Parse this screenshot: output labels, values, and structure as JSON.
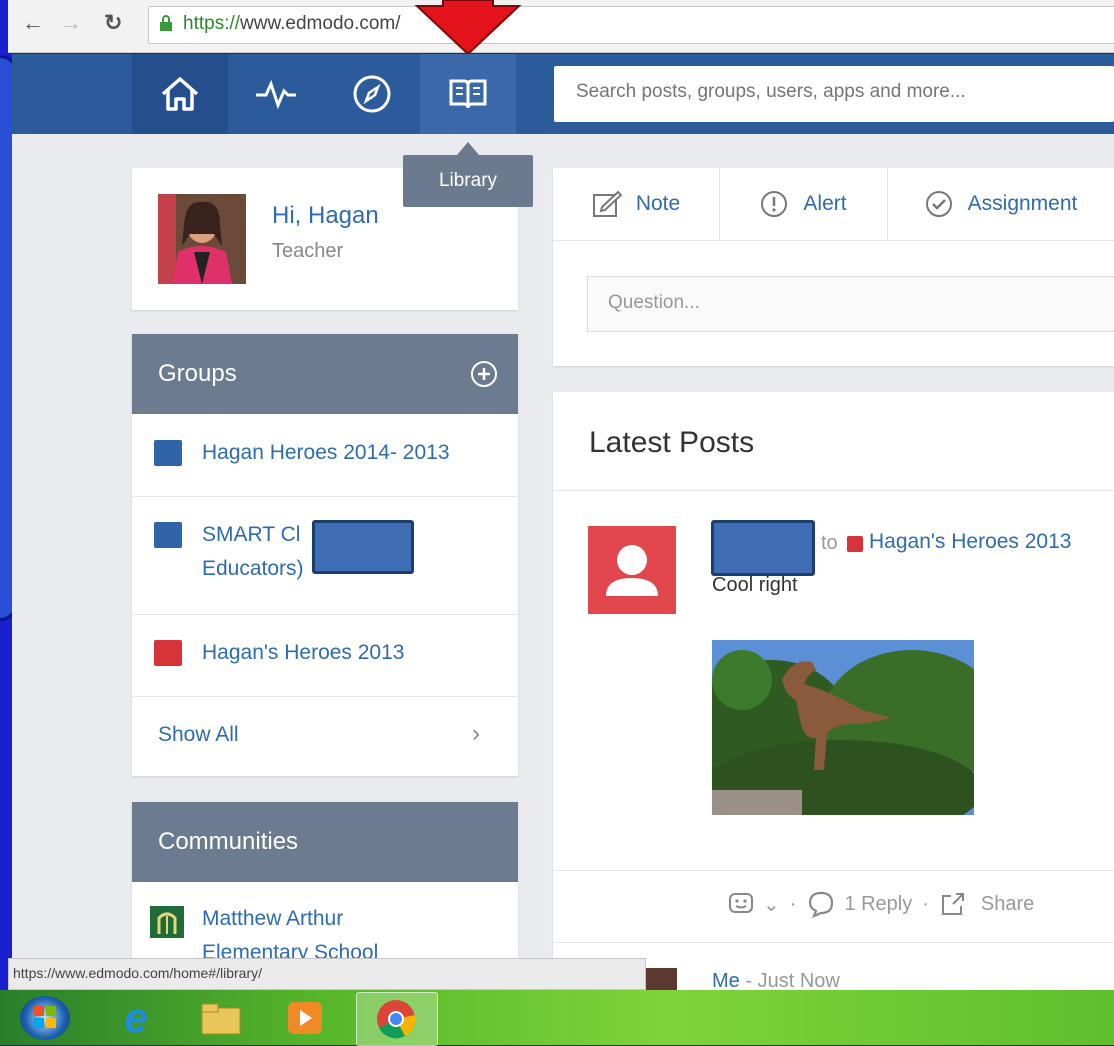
{
  "browser": {
    "url_scheme": "https://",
    "url_rest": "www.edmodo.com/"
  },
  "search": {
    "placeholder": "Search posts, groups, users, apps and more..."
  },
  "tooltip": {
    "label": "Library"
  },
  "profile": {
    "greeting": "Hi, Hagan",
    "role": "Teacher"
  },
  "groups": {
    "title": "Groups",
    "items": [
      {
        "label": "Hagan Heroes 2014- 2013",
        "color": "#2f64a8"
      },
      {
        "label_line1": "SMART Cl",
        "label_line2": "Educators)",
        "color": "#2f64a8"
      },
      {
        "label": "Hagan's Heroes 2013",
        "color": "#d63438"
      }
    ],
    "show_all": "Show All"
  },
  "communities": {
    "title": "Communities",
    "items": [
      {
        "label_line1": "Matthew Arthur",
        "label_line2": "Elementary School"
      }
    ]
  },
  "composer": {
    "tabs": [
      {
        "label": "Note"
      },
      {
        "label": "Alert"
      },
      {
        "label": "Assignment"
      }
    ],
    "question_placeholder": "Question..."
  },
  "posts": {
    "title": "Latest Posts",
    "item": {
      "to_word": "to",
      "group": "Hagan's Heroes 2013",
      "text": "Cool right",
      "reply_count": "1 Reply",
      "share": "Share"
    },
    "next_item": {
      "author": "Me",
      "time": "Just Now"
    }
  },
  "statusbar": {
    "url": "https://www.edmodo.com/home#/library/"
  }
}
